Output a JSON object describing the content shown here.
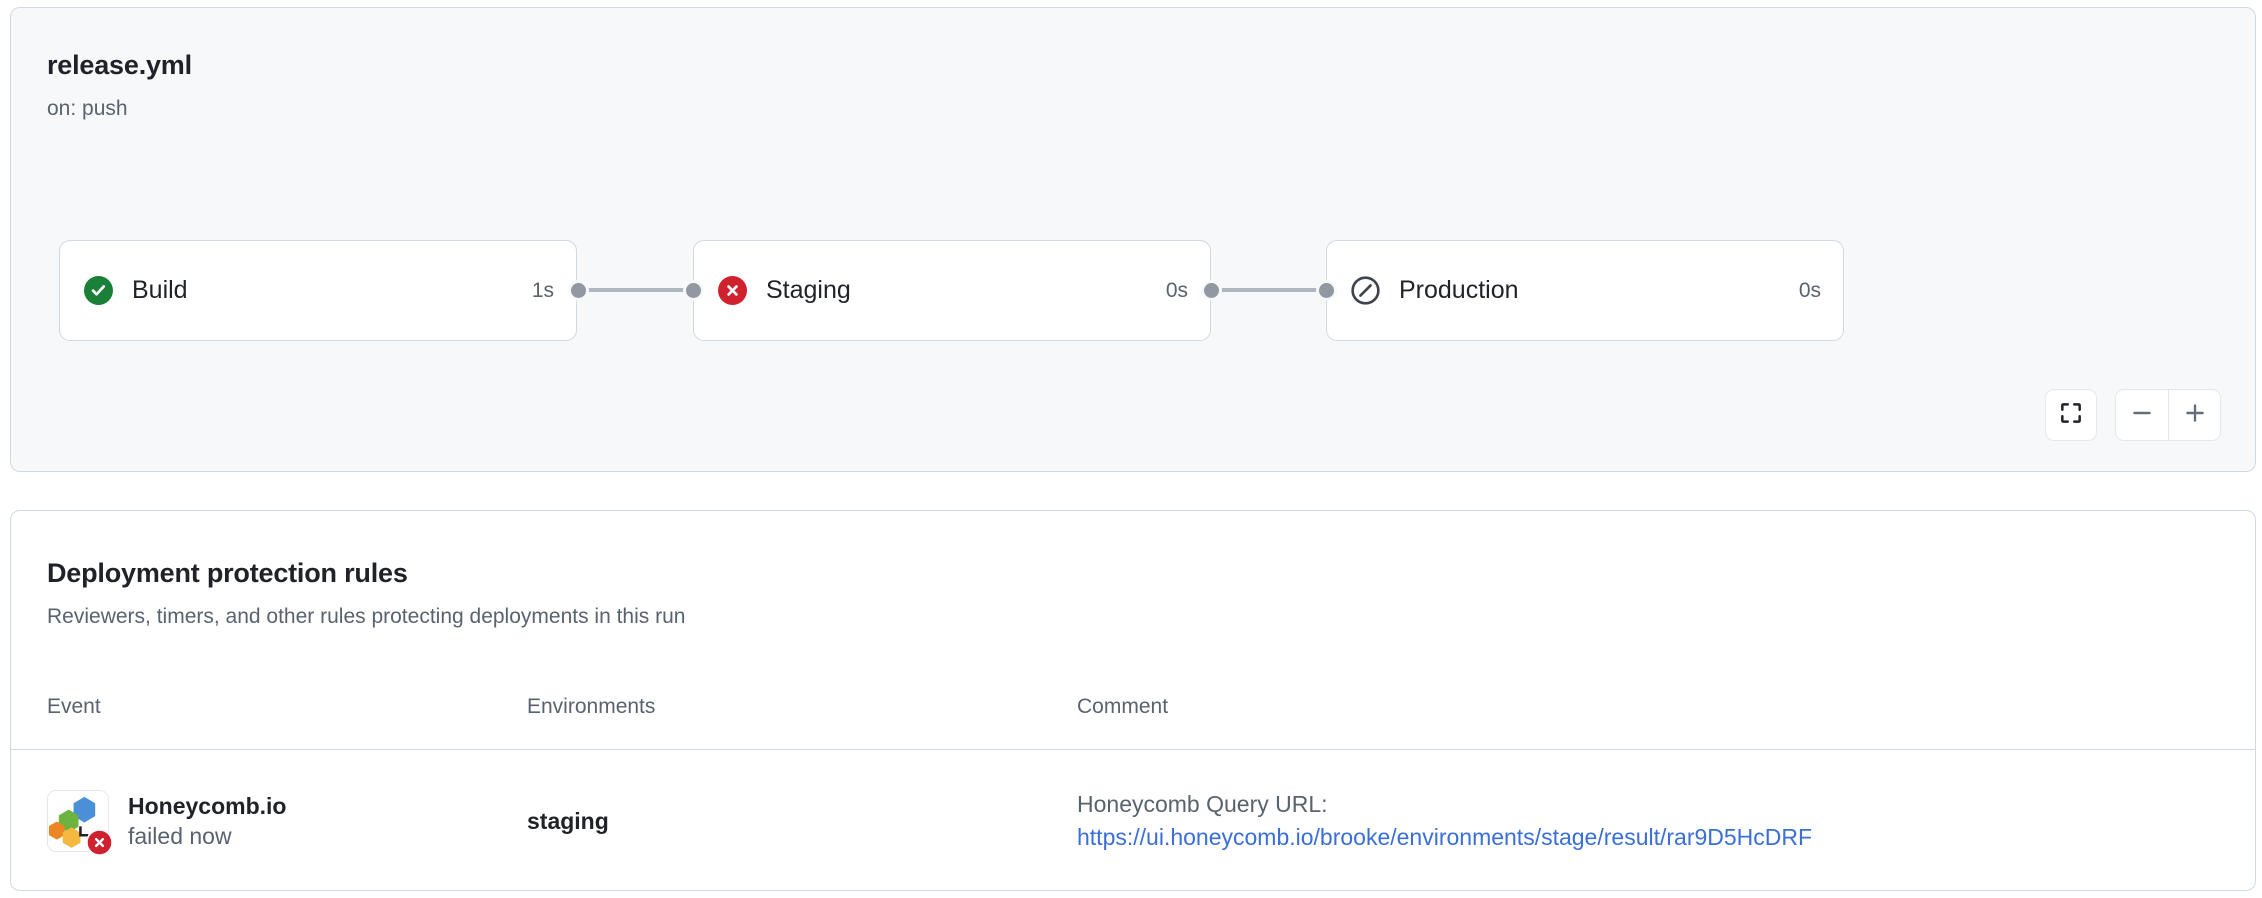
{
  "workflow": {
    "title": "release.yml",
    "trigger": "on: push",
    "nodes": [
      {
        "label": "Build",
        "duration": "1s",
        "status": "success",
        "status_icon": "check-circle-fill-icon"
      },
      {
        "label": "Staging",
        "duration": "0s",
        "status": "failure",
        "status_icon": "x-circle-fill-icon"
      },
      {
        "label": "Production",
        "duration": "0s",
        "status": "skipped",
        "status_icon": "skip-circle-icon"
      }
    ],
    "controls": {
      "fit_label": "fit-to-screen",
      "fit_icon": "fullscreen-icon",
      "zoom_out_label": "zoom-out",
      "zoom_out_icon": "minus-icon",
      "zoom_in_label": "zoom-in",
      "zoom_in_icon": "plus-icon"
    },
    "colors": {
      "success": "#1a7f37",
      "failure": "#cf222e",
      "skipped": "#59636e",
      "edge": "#afb8c1",
      "handle": "#9198a1",
      "card_bg": "#f6f8fa",
      "border": "#d1d9e0"
    }
  },
  "protection_rules": {
    "title": "Deployment protection rules",
    "subtitle": "Reviewers, timers, and other rules protecting deployments in this run",
    "columns": {
      "event": "Event",
      "environments": "Environments",
      "comment": "Comment"
    },
    "rows": [
      {
        "avatar_icon": "honeycomb-logo-icon",
        "badge_icon": "x-circle-fill-icon",
        "event_name": "Honeycomb.io",
        "event_status": "failed now",
        "environment": "staging",
        "comment_label": "Honeycomb Query URL:",
        "comment_link": "https://ui.honeycomb.io/brooke/environments/stage/result/rar9D5HcDRF"
      }
    ],
    "colors": {
      "link": "#3a6fd8",
      "muted": "#59636e"
    }
  }
}
